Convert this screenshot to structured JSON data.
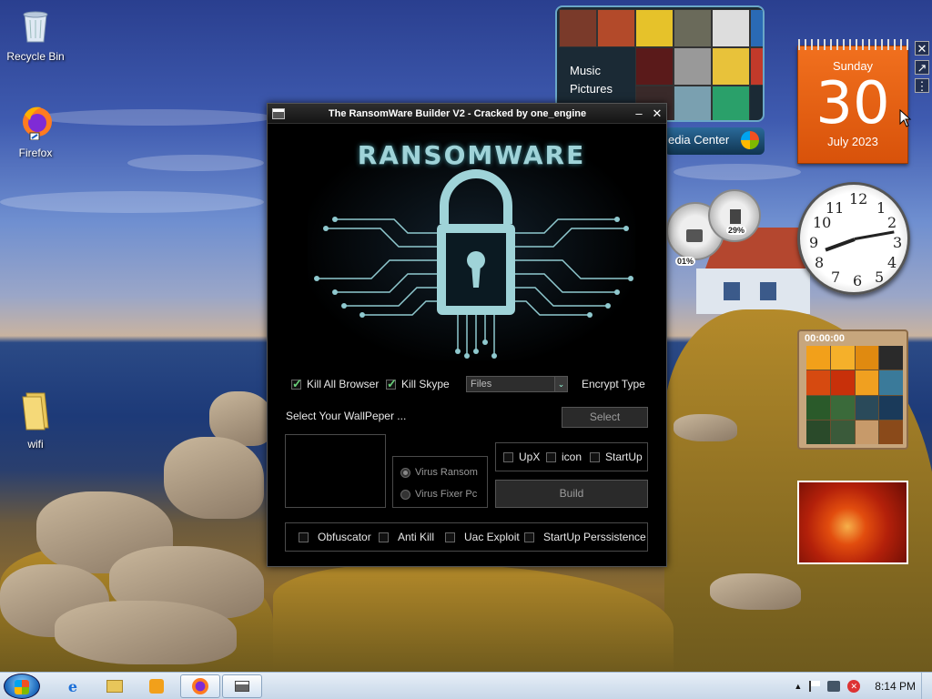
{
  "desktop": {
    "icons": [
      {
        "label": "Recycle Bin"
      },
      {
        "label": "Firefox"
      },
      {
        "label": "wifi"
      }
    ]
  },
  "gadgets": {
    "media_center": {
      "items": [
        "Music",
        "Pictures"
      ],
      "brand": "edia Center"
    },
    "calendar": {
      "weekday": "Sunday",
      "day": "30",
      "month_year": "July 2023"
    },
    "meters": {
      "cpu": "01%",
      "memory": "29%"
    },
    "puzzle": {
      "timer": "00:00:00"
    }
  },
  "window": {
    "title": "The RansomWare Builder V2 - Cracked by one_engine",
    "banner_title": "RANSOMWARE",
    "options": {
      "kill_all_browser": {
        "label": "Kill All Browser",
        "checked": true
      },
      "kill_skype": {
        "label": "Kill Skype",
        "checked": true
      },
      "encrypt_select_value": "Files",
      "encrypt_type_label": "Encrypt Type"
    },
    "wallpaper": {
      "label": "Select Your WallPeper ...",
      "select_button": "Select"
    },
    "mode": {
      "virus_ransom": "Virus Ransom",
      "virus_fixer": "Virus Fixer Pc",
      "selected": "virus_ransom"
    },
    "extras": {
      "upx": "UpX",
      "icon": "icon",
      "startup": "StartUp"
    },
    "build_button": "Build",
    "bottom_opts": {
      "obfuscator": "Obfuscator",
      "anti_kill": "Anti Kill",
      "uac_exploit": "Uac Exploit",
      "startup_persistence": "StartUp Perssistence"
    }
  },
  "taskbar": {
    "clock": "8:14 PM",
    "tray_expand": "▲"
  },
  "colors": {
    "accent_banner": "#9fd3d8",
    "window_bg": "#000000",
    "checkmark": "#6ad07a"
  }
}
